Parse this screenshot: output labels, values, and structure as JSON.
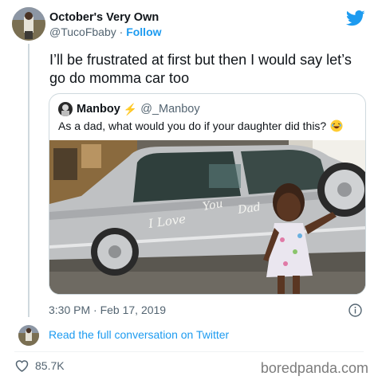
{
  "tweet": {
    "author_name": "October's Very Own",
    "author_handle": "@TucoFbaby",
    "separator": "·",
    "follow_label": "Follow",
    "text": "I’ll be frustrated at first but then I would say let’s go do momma car too",
    "timestamp": "3:30 PM · Feb 17, 2019",
    "like_count": "85.7K",
    "read_conversation_label": "Read the full conversation on Twitter"
  },
  "quoted_tweet": {
    "author_name": "Manboy",
    "badge": "⚡",
    "author_handle": "@_Manboy",
    "text": "As a dad, what would you do if your daughter did this?",
    "emoji": "😂",
    "photo_writing": [
      "I Love",
      "You",
      "Dad"
    ]
  },
  "watermark": "boredpanda.com",
  "colors": {
    "link_blue": "#1d9bf0",
    "text_primary": "#0f1419",
    "text_secondary": "#536471",
    "border": "#cfd9de"
  },
  "icons": {
    "brand": "twitter-bird-icon",
    "info": "info-icon",
    "like": "heart-icon"
  }
}
